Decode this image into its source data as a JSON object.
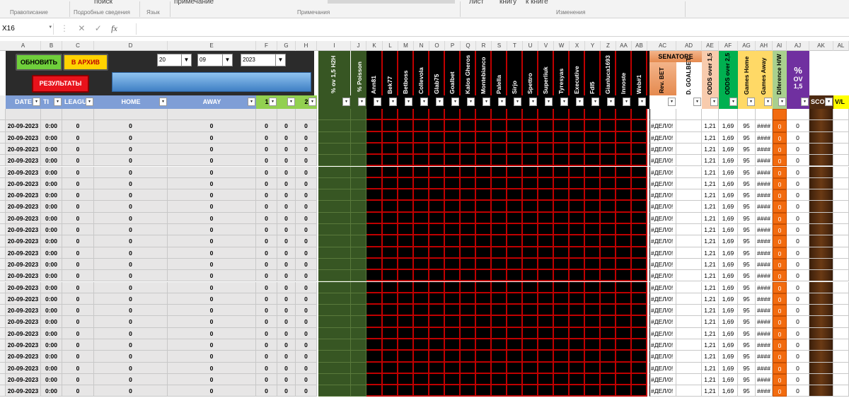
{
  "ribbon": {
    "items": [
      "поиск",
      "примечание",
      "лист",
      "книгу",
      "к книге"
    ],
    "groups": [
      "Правописание",
      "Подробные сведения",
      "Язык",
      "Примечания",
      "Изменения"
    ]
  },
  "formula_bar": {
    "name_box": "X16",
    "fx": "fx",
    "formula": ""
  },
  "column_letters": [
    "A",
    "B",
    "C",
    "D",
    "E",
    "F",
    "G",
    "H",
    "I",
    "J",
    "K",
    "L",
    "M",
    "N",
    "O",
    "P",
    "Q",
    "R",
    "S",
    "T",
    "U",
    "V",
    "W",
    "X",
    "Y",
    "Z",
    "AA",
    "AB",
    "AC",
    "AD",
    "AE",
    "AF",
    "AG",
    "AH",
    "AI",
    "AJ",
    "AK",
    "AL"
  ],
  "controls": {
    "update_button": "ОБНОВИТЬ",
    "archive_button": "В АРХИВ",
    "results_button": "РЕЗУЛЬТАТЫ",
    "day": "20",
    "month": "09",
    "year": "2023"
  },
  "top_labels": {
    "h2h": "% ov 1,5 H2H",
    "poisson": "% Poisson",
    "tipsters": [
      "Ann81",
      "Bek77",
      "Betboss",
      "Collevola",
      "Glab75",
      "Goalbet",
      "Kalos Gheros",
      "Montebianco",
      "Palella",
      "Sirjo",
      "Spettro",
      "Superliuk",
      "Tyresyas",
      "Executive",
      "Fdl5",
      "Gianluca1693",
      "Innoste",
      "Web#1"
    ],
    "senatore": "SENATORE",
    "rev_bet": "Rev. BET",
    "d_goalbet": "D. GOALBET",
    "odds_15": "ODDS over 1,5",
    "odds_25": "ODDS over 2,5",
    "games_home": "Games Home",
    "games_away": "Games Away",
    "diff_hw": "Diference H/W",
    "pct_ov_1": "%",
    "pct_ov_2": "OV",
    "pct_ov_3": "1,5"
  },
  "headers": {
    "date": "DATE",
    "time": "TI",
    "league": "LEAGU",
    "home": "HOME",
    "away": "AWAY",
    "f": "1",
    "g": "",
    "h": "2",
    "sco": "SCO",
    "vl": "V/L"
  },
  "row_numbers": [
    "",
    "",
    "",
    "",
    "",
    "",
    "",
    "",
    "",
    "",
    "",
    "",
    "",
    "",
    "",
    "",
    "",
    "",
    "",
    "",
    "",
    "",
    "",
    "",
    ""
  ],
  "rows": [
    {
      "date": "",
      "time": "",
      "league": "",
      "home": "",
      "away": "",
      "f": "",
      "g": "",
      "h": "",
      "ac": "",
      "ae": "",
      "af": "",
      "ag": "",
      "ah": "",
      "ai": "",
      "aj": ""
    },
    {
      "date": "20-09-2023",
      "time": "0:00",
      "league": "0",
      "home": "0",
      "away": "0",
      "f": "0",
      "g": "0",
      "h": "0",
      "ac": "#ДЕЛ/0!",
      "ae": "1,21",
      "af": "1,69",
      "ag": "95",
      "ah": "####",
      "ai": "0",
      "aj": "0"
    },
    {
      "date": "20-09-2023",
      "time": "0:00",
      "league": "0",
      "home": "0",
      "away": "0",
      "f": "0",
      "g": "0",
      "h": "0",
      "ac": "#ДЕЛ/0!",
      "ae": "1,21",
      "af": "1,69",
      "ag": "95",
      "ah": "####",
      "ai": "0",
      "aj": "0"
    },
    {
      "date": "20-09-2023",
      "time": "0:00",
      "league": "0",
      "home": "0",
      "away": "0",
      "f": "0",
      "g": "0",
      "h": "0",
      "ac": "#ДЕЛ/0!",
      "ae": "1,21",
      "af": "1,69",
      "ag": "95",
      "ah": "####",
      "ai": "0",
      "aj": "0"
    },
    {
      "date": "20-09-2023",
      "time": "0:00",
      "league": "0",
      "home": "0",
      "away": "0",
      "f": "0",
      "g": "0",
      "h": "0",
      "ac": "#ДЕЛ/0!",
      "ae": "1,21",
      "af": "1,69",
      "ag": "95",
      "ah": "####",
      "ai": "0",
      "aj": "0"
    },
    {
      "date": "20-09-2023",
      "time": "0:00",
      "league": "0",
      "home": "0",
      "away": "0",
      "f": "0",
      "g": "0",
      "h": "0",
      "ac": "#ДЕЛ/0!",
      "ae": "1,21",
      "af": "1,69",
      "ag": "95",
      "ah": "####",
      "ai": "0",
      "aj": "0"
    },
    {
      "date": "20-09-2023",
      "time": "0:00",
      "league": "0",
      "home": "0",
      "away": "0",
      "f": "0",
      "g": "0",
      "h": "0",
      "ac": "#ДЕЛ/0!",
      "ae": "1,21",
      "af": "1,69",
      "ag": "95",
      "ah": "####",
      "ai": "0",
      "aj": "0"
    },
    {
      "date": "20-09-2023",
      "time": "0:00",
      "league": "0",
      "home": "0",
      "away": "0",
      "f": "0",
      "g": "0",
      "h": "0",
      "ac": "#ДЕЛ/0!",
      "ae": "1,21",
      "af": "1,69",
      "ag": "95",
      "ah": "####",
      "ai": "0",
      "aj": "0"
    },
    {
      "date": "20-09-2023",
      "time": "0:00",
      "league": "0",
      "home": "0",
      "away": "0",
      "f": "0",
      "g": "0",
      "h": "0",
      "ac": "#ДЕЛ/0!",
      "ae": "1,21",
      "af": "1,69",
      "ag": "95",
      "ah": "####",
      "ai": "0",
      "aj": "0"
    },
    {
      "date": "20-09-2023",
      "time": "0:00",
      "league": "0",
      "home": "0",
      "away": "0",
      "f": "0",
      "g": "0",
      "h": "0",
      "ac": "#ДЕЛ/0!",
      "ae": "1,21",
      "af": "1,69",
      "ag": "95",
      "ah": "####",
      "ai": "0",
      "aj": "0"
    },
    {
      "date": "20-09-2023",
      "time": "0:00",
      "league": "0",
      "home": "0",
      "away": "0",
      "f": "0",
      "g": "0",
      "h": "0",
      "ac": "#ДЕЛ/0!",
      "ae": "1,21",
      "af": "1,69",
      "ag": "95",
      "ah": "####",
      "ai": "0",
      "aj": "0"
    },
    {
      "date": "20-09-2023",
      "time": "0:00",
      "league": "0",
      "home": "0",
      "away": "0",
      "f": "0",
      "g": "0",
      "h": "0",
      "ac": "#ДЕЛ/0!",
      "ae": "1,21",
      "af": "1,69",
      "ag": "95",
      "ah": "####",
      "ai": "0",
      "aj": "0"
    },
    {
      "date": "20-09-2023",
      "time": "0:00",
      "league": "0",
      "home": "0",
      "away": "0",
      "f": "0",
      "g": "0",
      "h": "0",
      "ac": "#ДЕЛ/0!",
      "ae": "1,21",
      "af": "1,69",
      "ag": "95",
      "ah": "####",
      "ai": "0",
      "aj": "0"
    },
    {
      "date": "20-09-2023",
      "time": "0:00",
      "league": "0",
      "home": "0",
      "away": "0",
      "f": "0",
      "g": "0",
      "h": "0",
      "ac": "#ДЕЛ/0!",
      "ae": "1,21",
      "af": "1,69",
      "ag": "95",
      "ah": "####",
      "ai": "0",
      "aj": "0"
    },
    {
      "date": "20-09-2023",
      "time": "0:00",
      "league": "0",
      "home": "0",
      "away": "0",
      "f": "0",
      "g": "0",
      "h": "0",
      "ac": "#ДЕЛ/0!",
      "ae": "1,21",
      "af": "1,69",
      "ag": "95",
      "ah": "####",
      "ai": "0",
      "aj": "0"
    },
    {
      "date": "20-09-2023",
      "time": "0:00",
      "league": "0",
      "home": "0",
      "away": "0",
      "f": "0",
      "g": "0",
      "h": "0",
      "ac": "#ДЕЛ/0!",
      "ae": "1,21",
      "af": "1,69",
      "ag": "95",
      "ah": "####",
      "ai": "0",
      "aj": "0"
    },
    {
      "date": "20-09-2023",
      "time": "0:00",
      "league": "0",
      "home": "0",
      "away": "0",
      "f": "0",
      "g": "0",
      "h": "0",
      "ac": "#ДЕЛ/0!",
      "ae": "1,21",
      "af": "1,69",
      "ag": "95",
      "ah": "####",
      "ai": "0",
      "aj": "0"
    },
    {
      "date": "20-09-2023",
      "time": "0:00",
      "league": "0",
      "home": "0",
      "away": "0",
      "f": "0",
      "g": "0",
      "h": "0",
      "ac": "#ДЕЛ/0!",
      "ae": "1,21",
      "af": "1,69",
      "ag": "95",
      "ah": "####",
      "ai": "0",
      "aj": "0"
    },
    {
      "date": "20-09-2023",
      "time": "0:00",
      "league": "0",
      "home": "0",
      "away": "0",
      "f": "0",
      "g": "0",
      "h": "0",
      "ac": "#ДЕЛ/0!",
      "ae": "1,21",
      "af": "1,69",
      "ag": "95",
      "ah": "####",
      "ai": "0",
      "aj": "0"
    },
    {
      "date": "20-09-2023",
      "time": "0:00",
      "league": "0",
      "home": "0",
      "away": "0",
      "f": "0",
      "g": "0",
      "h": "0",
      "ac": "#ДЕЛ/0!",
      "ae": "1,21",
      "af": "1,69",
      "ag": "95",
      "ah": "####",
      "ai": "0",
      "aj": "0"
    },
    {
      "date": "20-09-2023",
      "time": "0:00",
      "league": "0",
      "home": "0",
      "away": "0",
      "f": "0",
      "g": "0",
      "h": "0",
      "ac": "#ДЕЛ/0!",
      "ae": "1,21",
      "af": "1,69",
      "ag": "95",
      "ah": "####",
      "ai": "0",
      "aj": "0"
    },
    {
      "date": "20-09-2023",
      "time": "0:00",
      "league": "0",
      "home": "0",
      "away": "0",
      "f": "0",
      "g": "0",
      "h": "0",
      "ac": "#ДЕЛ/0!",
      "ae": "1,21",
      "af": "1,69",
      "ag": "95",
      "ah": "####",
      "ai": "0",
      "aj": "0"
    },
    {
      "date": "20-09-2023",
      "time": "0:00",
      "league": "0",
      "home": "0",
      "away": "0",
      "f": "0",
      "g": "0",
      "h": "0",
      "ac": "#ДЕЛ/0!",
      "ae": "1,21",
      "af": "1,69",
      "ag": "95",
      "ah": "####",
      "ai": "0",
      "aj": "0"
    },
    {
      "date": "20-09-2023",
      "time": "0:00",
      "league": "0",
      "home": "0",
      "away": "0",
      "f": "0",
      "g": "0",
      "h": "0",
      "ac": "#ДЕЛ/0!",
      "ae": "1,21",
      "af": "1,69",
      "ag": "95",
      "ah": "####",
      "ai": "0",
      "aj": "0"
    },
    {
      "date": "20-09-2023",
      "time": "0:00",
      "league": "0",
      "home": "0",
      "away": "0",
      "f": "0",
      "g": "0",
      "h": "0",
      "ac": "#ДЕЛ/0!",
      "ae": "1,21",
      "af": "1,69",
      "ag": "95",
      "ah": "####",
      "ai": "0",
      "aj": "0"
    }
  ],
  "colors": {
    "green_button": "#6fcf3b",
    "yellow_button": "#ffd200",
    "red_button": "#e8121b",
    "blue_bar": "#4f8fcf",
    "dark_header": "#2b2b2b",
    "olive": "#375623",
    "grid_black": "#000000",
    "grid_red": "#c00000",
    "orange": "#f26b0f",
    "brown": "#4d2a10"
  }
}
